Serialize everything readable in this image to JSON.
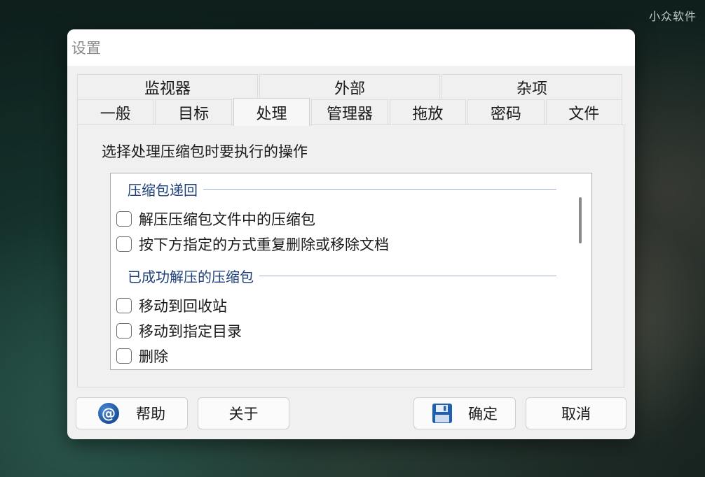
{
  "watermark": "小众软件",
  "window": {
    "title": "设置"
  },
  "tabs": {
    "row1": [
      "监视器",
      "外部",
      "杂项"
    ],
    "row2": [
      "一般",
      "目标",
      "处理",
      "管理器",
      "拖放",
      "密码",
      "文件"
    ],
    "active": "处理"
  },
  "panel": {
    "instruction": "选择处理压缩包时要执行的操作",
    "groups": [
      {
        "title": "压缩包递回",
        "items": [
          "解压压缩包文件中的压缩包",
          "按下方指定的方式重复删除或移除文档"
        ]
      },
      {
        "title": "已成功解压的压缩包",
        "items": [
          "移动到回收站",
          "移动到指定目录",
          "删除"
        ]
      }
    ]
  },
  "buttons": {
    "help": "帮助",
    "about": "关于",
    "ok": "确定",
    "cancel": "取消"
  },
  "icons": {
    "help": "at-icon",
    "ok": "floppy-disk-icon"
  },
  "colors": {
    "group_header": "#1f3f7a",
    "divider": "#9fb0cc",
    "dialog_bg": "#f0f0f0"
  }
}
